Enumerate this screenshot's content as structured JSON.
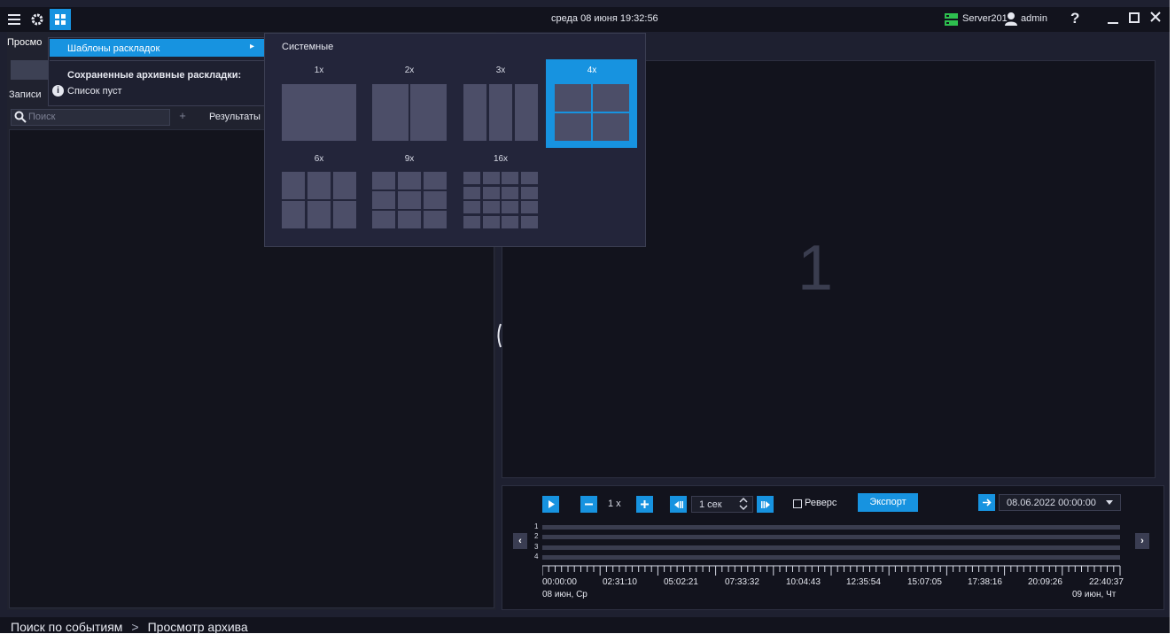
{
  "topbar": {
    "menu_icon": "hamburger-icon",
    "settings_icon": "gear-icon",
    "layout_icon": "layout-grid-icon",
    "datetime": "среда 08 июня 19:32:56",
    "server_name": "Server201",
    "user_name": "admin",
    "help": "?"
  },
  "left": {
    "tab_view": "Просмо",
    "records_label": "Записи",
    "search_placeholder": "Поиск",
    "add": "+",
    "results_label": "Результаты"
  },
  "layout_menu": {
    "templates_item": "Шаблоны раскладок",
    "arrow": "▸",
    "saved_header": "Сохраненные архивные раскладки:",
    "empty_label": "Список пуст",
    "info_glyph": "i"
  },
  "templates": {
    "header": "Системные",
    "items": [
      {
        "label": "1x"
      },
      {
        "label": "2x"
      },
      {
        "label": "3x"
      },
      {
        "label": "4x",
        "selected": true
      },
      {
        "label": "6x"
      },
      {
        "label": "9x"
      },
      {
        "label": "16x"
      }
    ]
  },
  "viewer": {
    "viewport_number": "1"
  },
  "playback": {
    "speed": "1 x",
    "step_value": "1 сек",
    "reverse_label": "Реверс",
    "export_label": "Экспорт",
    "datetime_value": "08.06.2022  00:00:00",
    "tracks": [
      "1",
      "2",
      "3",
      "4"
    ],
    "time_ticks": [
      "00:00:00",
      "02:31:10",
      "05:02:21",
      "07:33:32",
      "10:04:43",
      "12:35:54",
      "15:07:05",
      "17:38:16",
      "20:09:26",
      "22:40:37"
    ],
    "start_date": "08 июн, Ср",
    "end_date": "09 июн, Чт"
  },
  "statusbar": {
    "crumb_1": "Поиск по событиям",
    "separator": ">",
    "crumb_2": "Просмотр архива"
  },
  "colors": {
    "accent": "#1793e0",
    "background": "#1e2030",
    "server_green": "#2ec04f"
  }
}
